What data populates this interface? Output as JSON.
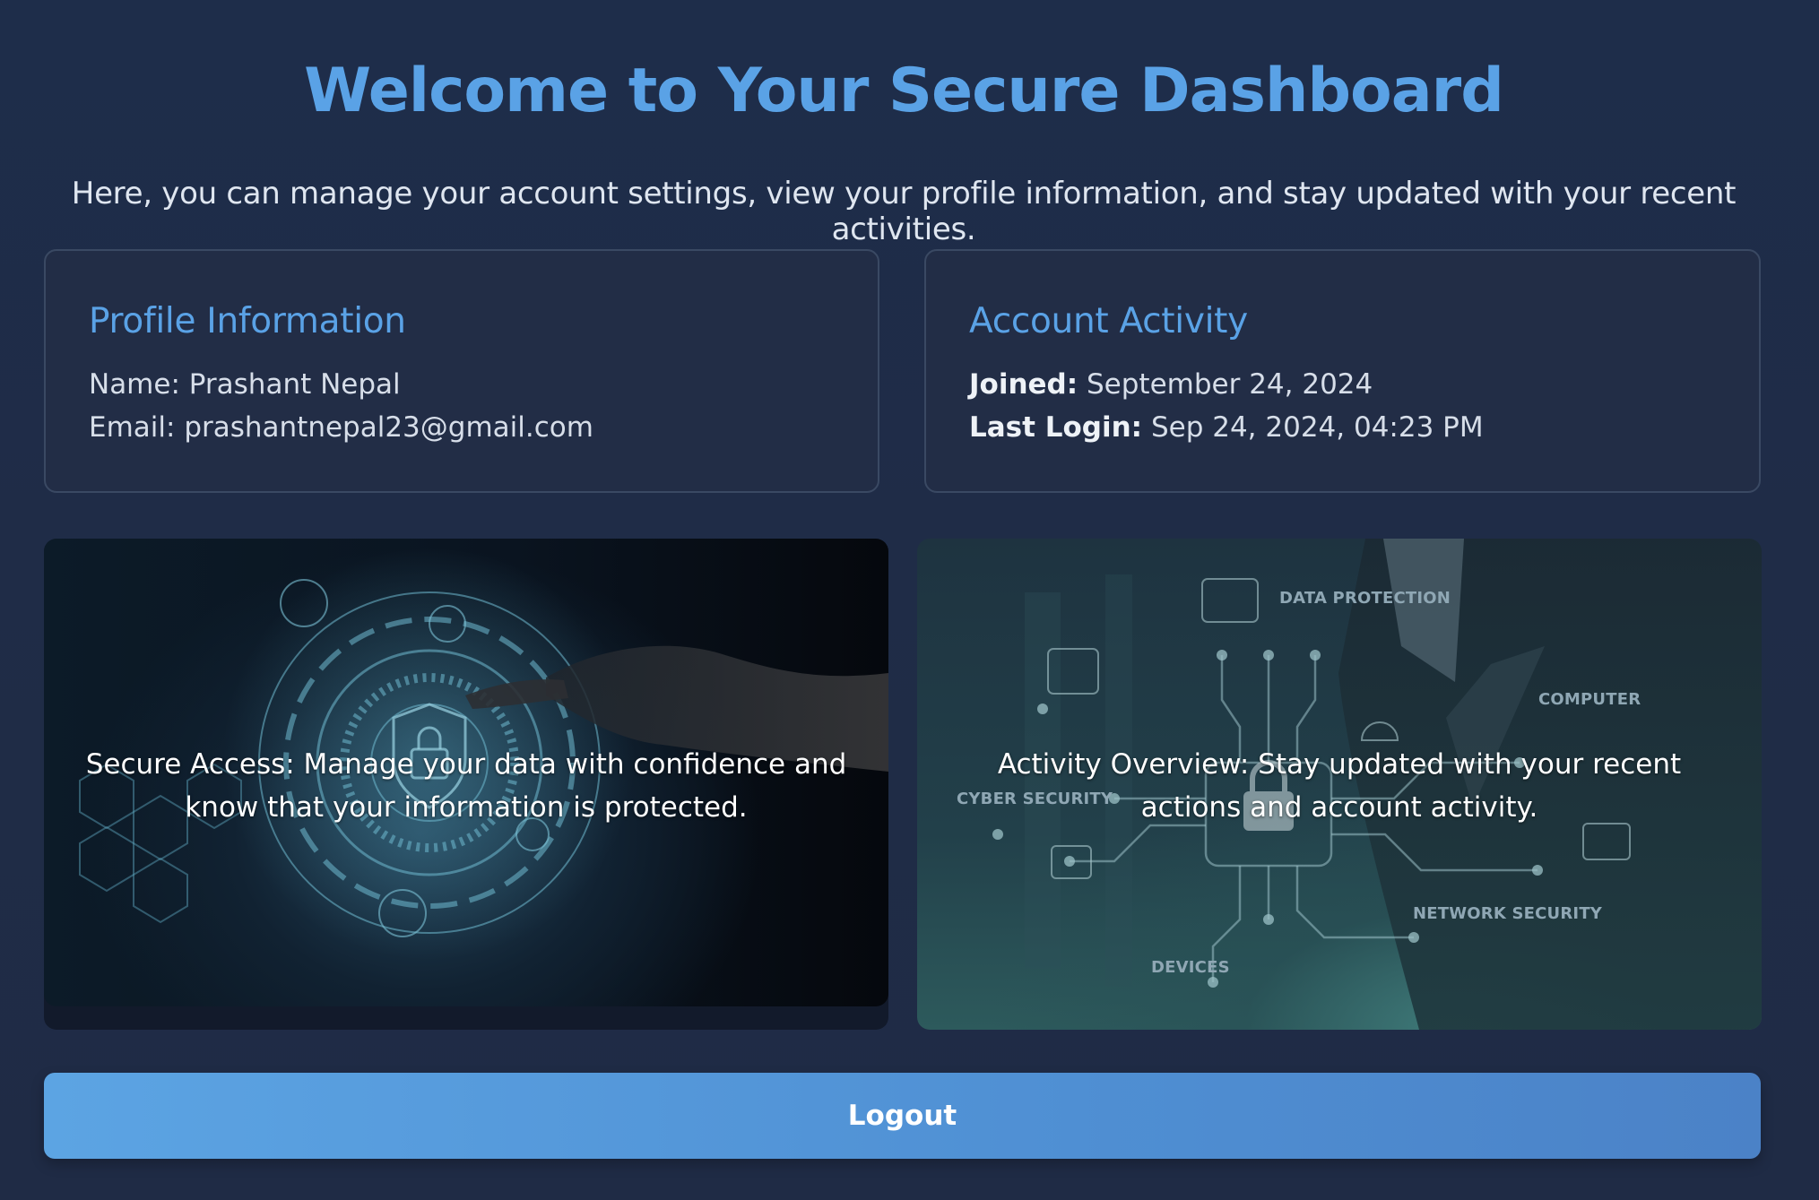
{
  "header": {
    "title": "Welcome to Your Secure Dashboard",
    "subtitle": "Here, you can manage your account settings, view your profile information, and stay updated with your recent activities."
  },
  "profile": {
    "heading": "Profile Information",
    "name_label": "Name:",
    "name_value": "Prashant Nepal",
    "email_label": "Email:",
    "email_value": "prashantnepal23@gmail.com"
  },
  "activity": {
    "heading": "Account Activity",
    "joined_label": "Joined:",
    "joined_value": "September 24, 2024",
    "last_login_label": "Last Login:",
    "last_login_value": "Sep 24, 2024, 04:23 PM"
  },
  "feature_cards": {
    "secure_access": "Secure Access: Manage your data with confidence and know that your information is protected.",
    "activity_overview": "Activity Overview: Stay updated with your recent actions and account activity.",
    "image_labels": {
      "data_protection": "DATA PROTECTION",
      "computer": "COMPUTER",
      "cyber_security": "CYBER SECURITY",
      "network_security": "NETWORK SECURITY",
      "devices": "DEVICES"
    }
  },
  "actions": {
    "logout_label": "Logout"
  },
  "colors": {
    "accent": "#5aa2e6",
    "background": "#1f2c47",
    "card_border": "#3a4963"
  }
}
